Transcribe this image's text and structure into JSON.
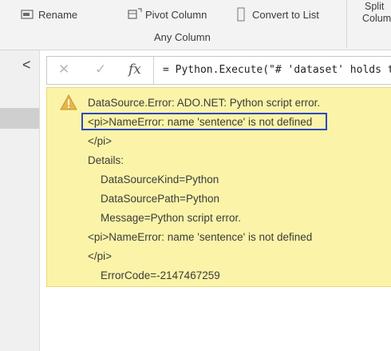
{
  "ribbon": {
    "rename_label": "Rename",
    "pivot_column_label": "Pivot Column",
    "convert_to_list_label": "Convert to List",
    "any_column_group_label": "Any Column",
    "split_column_label_line1": "Split",
    "split_column_label_line2": "Column"
  },
  "left_pane": {
    "collapse_glyph": "<"
  },
  "formula_bar": {
    "cancel_glyph": "✕",
    "confirm_glyph": "✓",
    "fx_label": "fx",
    "formula_text": "= Python.Execute(\"# 'dataset' holds t"
  },
  "error": {
    "line1": "DataSource.Error: ADO.NET: Python script error.",
    "line2": "<pi>NameError: name 'sentence' is not defined",
    "line3": "</pi>",
    "line4": "Details:",
    "line5": "DataSourceKind=Python",
    "line6": "DataSourcePath=Python",
    "line7": "Message=Python script error.",
    "line8": "<pi>NameError: name 'sentence' is not defined",
    "line9": "</pi>",
    "line10": "ErrorCode=-2147467259"
  },
  "colors": {
    "error_background": "#fbf4a8",
    "highlight_border": "#2d46c4",
    "warning_fill": "#e8b54a"
  }
}
